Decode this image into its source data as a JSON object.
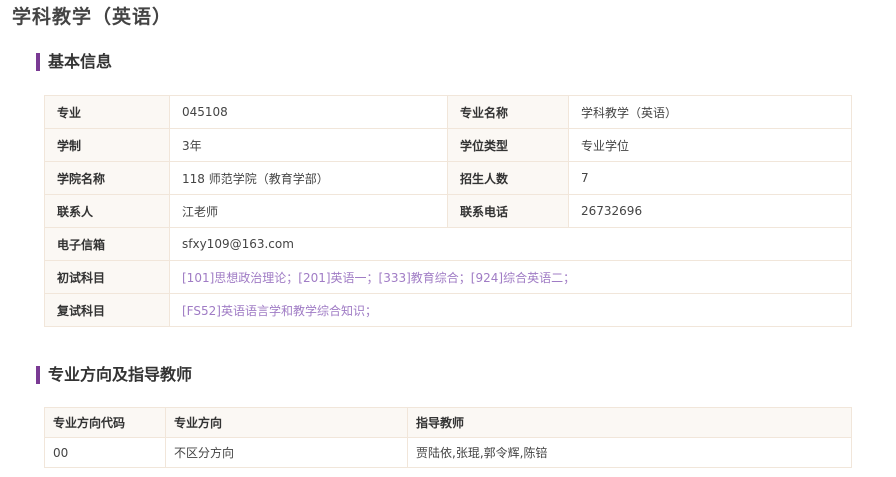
{
  "page_title": "学科教学（英语）",
  "basic_info": {
    "heading": "基本信息",
    "major_label": "专业",
    "major_value": "045108",
    "major_name_label": "专业名称",
    "major_name_value": "学科教学（英语）",
    "duration_label": "学制",
    "duration_value": "3年",
    "degree_type_label": "学位类型",
    "degree_type_value": "专业学位",
    "college_label": "学院名称",
    "college_value": "118 师范学院（教育学部）",
    "enrollment_label": "招生人数",
    "enrollment_value": "7",
    "contact_label": "联系人",
    "contact_value": "江老师",
    "phone_label": "联系电话",
    "phone_value": "26732696",
    "email_label": "电子信箱",
    "email_value": "sfxy109@163.com",
    "prelim_label": "初试科目",
    "prelim_value": "[101]思想政治理论；[201]英语一；[333]教育综合；[924]综合英语二；",
    "retest_label": "复试科目",
    "retest_value": "[FS52]英语语言学和教学综合知识；"
  },
  "directions": {
    "heading": "专业方向及指导教师",
    "columns": [
      "专业方向代码",
      "专业方向",
      "指导教师"
    ],
    "rows": [
      {
        "code": "00",
        "direction": "不区分方向",
        "advisors": "贾陆依,张琨,郭令辉,陈锫"
      }
    ]
  }
}
